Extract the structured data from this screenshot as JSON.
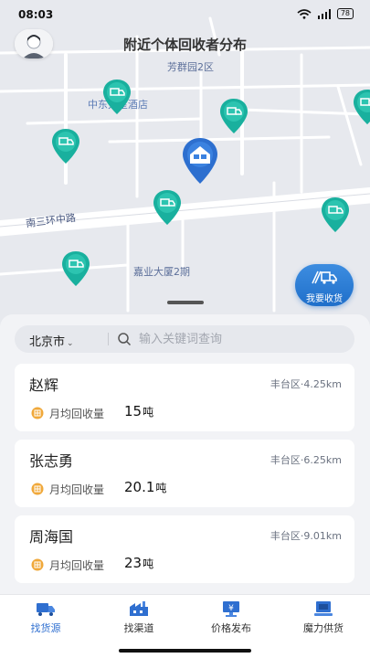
{
  "status_bar": {
    "time": "08:03",
    "battery": "78"
  },
  "map": {
    "title": "附近个体回收者分布",
    "labels": {
      "fangqun": "芳群园2区",
      "hotel": "中东大星酒店",
      "road": "南三环中路",
      "jiaye": "嘉业大厦2期"
    },
    "fab_label": "我要收货"
  },
  "search": {
    "city": "北京市",
    "placeholder": "输入关键词查询"
  },
  "collectors": [
    {
      "name": "赵辉",
      "district": "丰台区",
      "distance": "4.25km",
      "volume_label": "月均回收量",
      "volume": "15",
      "unit": "吨"
    },
    {
      "name": "张志勇",
      "district": "丰台区",
      "distance": "6.25km",
      "volume_label": "月均回收量",
      "volume": "20.1",
      "unit": "吨"
    },
    {
      "name": "周海国",
      "district": "丰台区",
      "distance": "9.01km",
      "volume_label": "月均回收量",
      "volume": "23",
      "unit": "吨"
    }
  ],
  "tabs": [
    {
      "label": "找货源",
      "icon": "truck-icon"
    },
    {
      "label": "找渠道",
      "icon": "factory-icon"
    },
    {
      "label": "价格发布",
      "icon": "price-board-icon"
    },
    {
      "label": "魔力供货",
      "icon": "supply-icon"
    }
  ],
  "colors": {
    "accent": "#2f6fd0",
    "pin": "#1ab0a0",
    "badge": "#f0a83a"
  }
}
